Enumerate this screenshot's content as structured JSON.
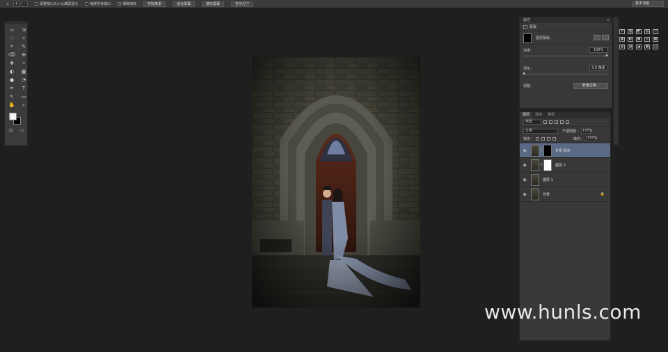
{
  "optbar": {
    "tool_icon": "zoom-icon",
    "zoom_in": "+",
    "zoom_out": "-",
    "checks": [
      {
        "label": "调整窗口大小以满屏显示",
        "checked": false
      },
      {
        "label": "缩放所有窗口",
        "checked": false
      },
      {
        "label": "细微缩放",
        "checked": true
      }
    ],
    "buttons": [
      "实际像素",
      "适合屏幕",
      "填充屏幕",
      "打印尺寸"
    ],
    "workspace": "基本功能"
  },
  "tools": [
    "▭",
    "⇲",
    "◌",
    "✧",
    "⌗",
    "✎",
    "⌫",
    "✜",
    "✚",
    "⌁",
    "◐",
    "▦",
    "●",
    "◔",
    "✒",
    "T",
    "↖",
    "▭",
    "✋",
    "⌕"
  ],
  "properties": {
    "title": "属性",
    "mask_label": "蒙版",
    "layer_mask_label": "图层蒙版",
    "density_label": "浓度：",
    "density_value": "100%",
    "feather_label": "羽化：",
    "feather_value": "0.0 像素",
    "adjust_label": "调整：",
    "edge_button": "蒙版边缘..."
  },
  "adjustments_icons": [
    "☀",
    "▥",
    "◩",
    "▤",
    "▽",
    "▦",
    "◐",
    "▣",
    "◎",
    "▦",
    "▧",
    "▨",
    "◪",
    "▩",
    "◫"
  ],
  "layers": {
    "tabs": [
      "图层",
      "通道",
      "路径"
    ],
    "filter_kind": "类型",
    "blend_mode": "正常",
    "opacity_label": "不透明度：",
    "opacity_value": "100%",
    "lock_label": "锁定：",
    "fill_label": "填充：",
    "fill_value": "100%",
    "items": [
      {
        "name": "背景 副本",
        "selected": true,
        "has_mask": true,
        "mask_white": false
      },
      {
        "name": "图层 2",
        "selected": false,
        "has_mask": true,
        "mask_white": true
      },
      {
        "name": "图层 1",
        "selected": false,
        "has_mask": false
      },
      {
        "name": "背景",
        "selected": false,
        "has_mask": false,
        "locked": true
      }
    ]
  },
  "watermark": "www.hunls.com"
}
